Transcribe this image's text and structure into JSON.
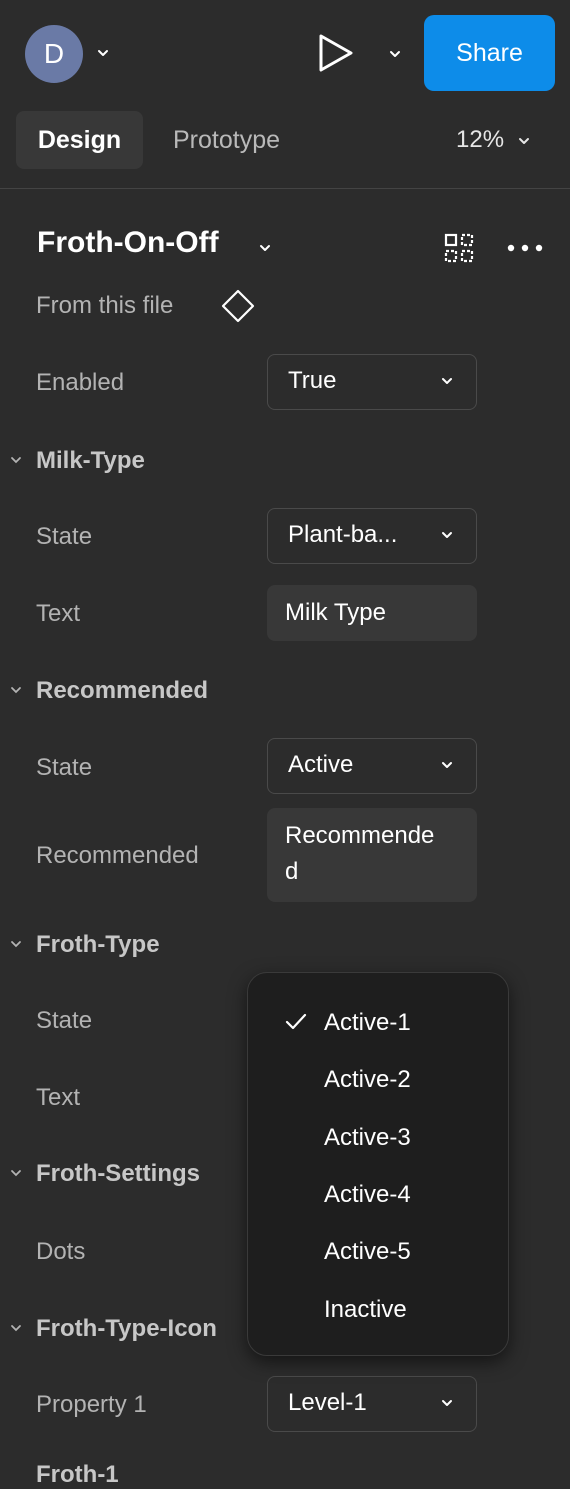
{
  "header": {
    "avatar_initial": "D",
    "share_label": "Share"
  },
  "tabs": {
    "design": "Design",
    "prototype": "Prototype",
    "zoom": "12%"
  },
  "component": {
    "title": "Froth-On-Off",
    "source": "From this file"
  },
  "properties": {
    "enabled_label": "Enabled",
    "enabled_value": "True",
    "milk_type": {
      "section": "Milk-Type",
      "state_label": "State",
      "state_value": "Plant-ba...",
      "text_label": "Text",
      "text_value": "Milk Type"
    },
    "recommended": {
      "section": "Recommended",
      "state_label": "State",
      "state_value": "Active",
      "text_label": "Recommended",
      "text_value_line1": "Recommende",
      "text_value_line2": "d"
    },
    "froth_type": {
      "section": "Froth-Type",
      "state_label": "State",
      "text_label": "Text"
    },
    "froth_settings": {
      "section": "Froth-Settings",
      "dots_label": "Dots"
    },
    "froth_type_icons": {
      "section": "Froth-Type-Icon",
      "property_label": "Property 1",
      "property_value": "Level-1"
    },
    "cut_off_section": "Froth-1"
  },
  "dropdown": {
    "options": [
      "Active-1",
      "Active-2",
      "Active-3",
      "Active-4",
      "Active-5",
      "Inactive"
    ],
    "selected": "Active-1"
  },
  "colors": {
    "accent": "#0d8ce9",
    "panel_bg": "#2c2c2c",
    "menu_bg": "#1e1e1e",
    "avatar": "#6a7aa6"
  }
}
